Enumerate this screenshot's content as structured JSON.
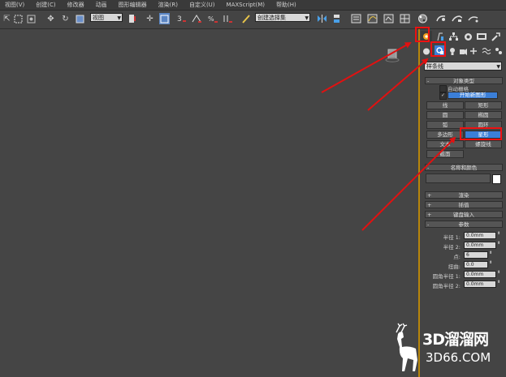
{
  "menu": [
    "视图(V)",
    "创建(C)",
    "修改器",
    "动画",
    "图形编辑器",
    "渲染(R)",
    "自定义(U)",
    "MAXScript(M)",
    "帮助(H)"
  ],
  "toolbar": {
    "view_dropdown": "视图",
    "selection_set_dropdown": "创建选择集",
    "icons": [
      "select-icon",
      "rect-select-icon",
      "window-crossing-icon",
      "move-icon",
      "rotate-icon",
      "scale-icon",
      "pivot-icon",
      "select-manipulate-icon",
      "snap-icon",
      "angle-snap-icon",
      "percent-snap-icon",
      "spinner-snap-icon",
      "edit-named-sel-icon",
      "mirror-icon",
      "align-icon",
      "layer-icon",
      "curve-editor-icon",
      "schematic-icon",
      "material-editor-icon",
      "render-setup-icon",
      "render-frame-icon",
      "render-icon"
    ]
  },
  "command_panel": {
    "tabs": [
      "create-tab",
      "modify-tab",
      "hierarchy-tab",
      "motion-tab",
      "display-tab",
      "utilities-tab"
    ],
    "category_icons": [
      "geometry-icon",
      "shapes-icon",
      "lights-icon",
      "cameras-icon",
      "helpers-icon",
      "spacewarps-icon",
      "systems-icon"
    ],
    "subcategory": "样条线",
    "object_type": {
      "header": "对象类型",
      "auto_grid": "自动栅格",
      "start_new_shape": "开始新图形",
      "buttons": [
        "线",
        "矩形",
        "圆",
        "椭圆",
        "弧",
        "圆环",
        "多边形",
        "星形",
        "文本",
        "螺旋线",
        "截面"
      ],
      "selected": "星形"
    },
    "name_color": {
      "header": "名称和颜色",
      "name_value": "",
      "color": "#ffffff"
    },
    "rollouts": [
      "渲染",
      "插值",
      "键盘输入"
    ],
    "params": {
      "header": "参数",
      "fields": [
        {
          "label": "半径 1:",
          "value": "0.0mm"
        },
        {
          "label": "半径 2:",
          "value": "0.0mm"
        },
        {
          "label": "点:",
          "value": "6"
        },
        {
          "label": "扭曲:",
          "value": "0.0"
        },
        {
          "label": "圆角半径 1:",
          "value": "0.0mm"
        },
        {
          "label": "圆角半径 2:",
          "value": "0.0mm"
        }
      ]
    }
  },
  "watermark": {
    "brand": "3D溜溜网",
    "url": "3D66.COM"
  },
  "colors": {
    "accent_red": "#e11111",
    "selected_blue": "#3b7fd8",
    "panel_border": "#b8860b"
  }
}
